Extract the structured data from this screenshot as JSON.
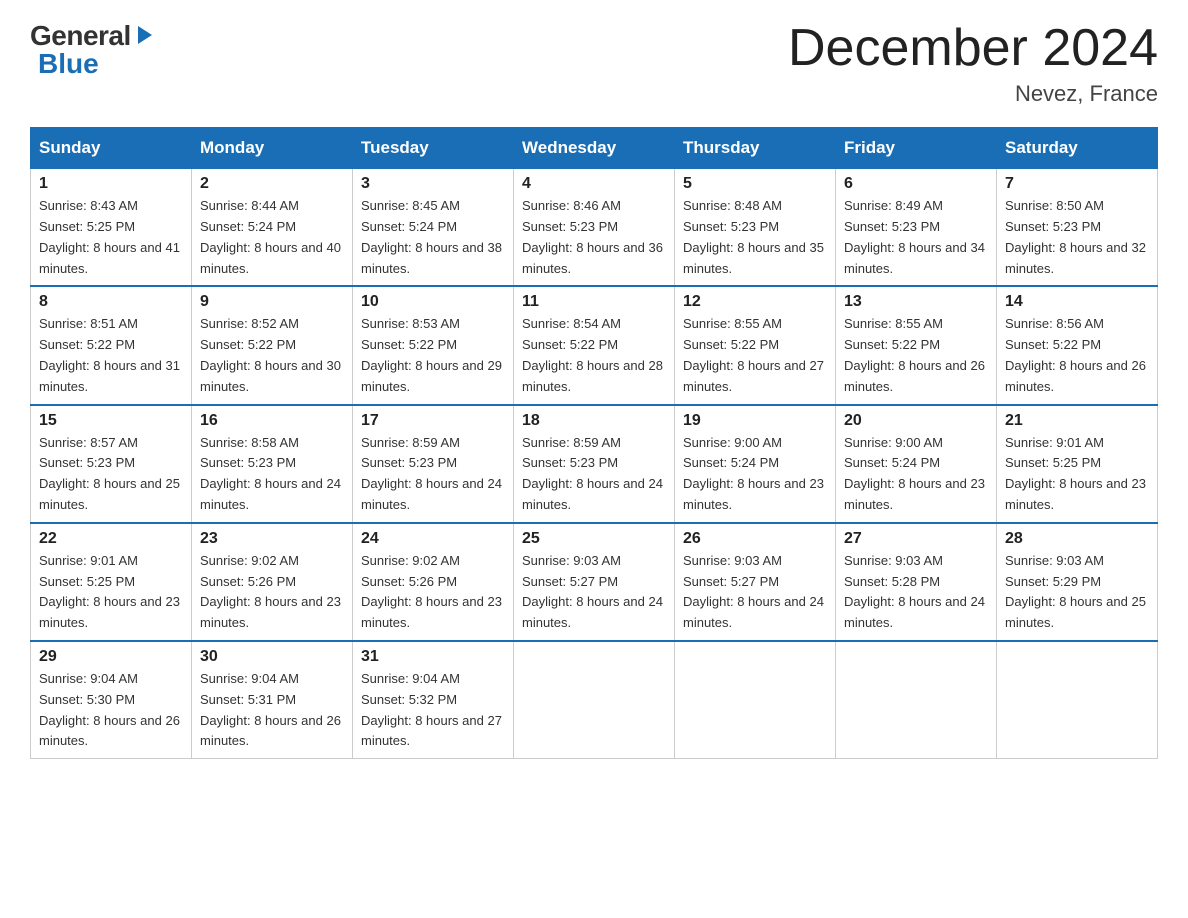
{
  "header": {
    "logo_general": "General",
    "logo_blue": "Blue",
    "title": "December 2024",
    "subtitle": "Nevez, France"
  },
  "calendar": {
    "weekdays": [
      "Sunday",
      "Monday",
      "Tuesday",
      "Wednesday",
      "Thursday",
      "Friday",
      "Saturday"
    ],
    "weeks": [
      [
        {
          "day": "1",
          "sunrise": "8:43 AM",
          "sunset": "5:25 PM",
          "daylight": "8 hours and 41 minutes."
        },
        {
          "day": "2",
          "sunrise": "8:44 AM",
          "sunset": "5:24 PM",
          "daylight": "8 hours and 40 minutes."
        },
        {
          "day": "3",
          "sunrise": "8:45 AM",
          "sunset": "5:24 PM",
          "daylight": "8 hours and 38 minutes."
        },
        {
          "day": "4",
          "sunrise": "8:46 AM",
          "sunset": "5:23 PM",
          "daylight": "8 hours and 36 minutes."
        },
        {
          "day": "5",
          "sunrise": "8:48 AM",
          "sunset": "5:23 PM",
          "daylight": "8 hours and 35 minutes."
        },
        {
          "day": "6",
          "sunrise": "8:49 AM",
          "sunset": "5:23 PM",
          "daylight": "8 hours and 34 minutes."
        },
        {
          "day": "7",
          "sunrise": "8:50 AM",
          "sunset": "5:23 PM",
          "daylight": "8 hours and 32 minutes."
        }
      ],
      [
        {
          "day": "8",
          "sunrise": "8:51 AM",
          "sunset": "5:22 PM",
          "daylight": "8 hours and 31 minutes."
        },
        {
          "day": "9",
          "sunrise": "8:52 AM",
          "sunset": "5:22 PM",
          "daylight": "8 hours and 30 minutes."
        },
        {
          "day": "10",
          "sunrise": "8:53 AM",
          "sunset": "5:22 PM",
          "daylight": "8 hours and 29 minutes."
        },
        {
          "day": "11",
          "sunrise": "8:54 AM",
          "sunset": "5:22 PM",
          "daylight": "8 hours and 28 minutes."
        },
        {
          "day": "12",
          "sunrise": "8:55 AM",
          "sunset": "5:22 PM",
          "daylight": "8 hours and 27 minutes."
        },
        {
          "day": "13",
          "sunrise": "8:55 AM",
          "sunset": "5:22 PM",
          "daylight": "8 hours and 26 minutes."
        },
        {
          "day": "14",
          "sunrise": "8:56 AM",
          "sunset": "5:22 PM",
          "daylight": "8 hours and 26 minutes."
        }
      ],
      [
        {
          "day": "15",
          "sunrise": "8:57 AM",
          "sunset": "5:23 PM",
          "daylight": "8 hours and 25 minutes."
        },
        {
          "day": "16",
          "sunrise": "8:58 AM",
          "sunset": "5:23 PM",
          "daylight": "8 hours and 24 minutes."
        },
        {
          "day": "17",
          "sunrise": "8:59 AM",
          "sunset": "5:23 PM",
          "daylight": "8 hours and 24 minutes."
        },
        {
          "day": "18",
          "sunrise": "8:59 AM",
          "sunset": "5:23 PM",
          "daylight": "8 hours and 24 minutes."
        },
        {
          "day": "19",
          "sunrise": "9:00 AM",
          "sunset": "5:24 PM",
          "daylight": "8 hours and 23 minutes."
        },
        {
          "day": "20",
          "sunrise": "9:00 AM",
          "sunset": "5:24 PM",
          "daylight": "8 hours and 23 minutes."
        },
        {
          "day": "21",
          "sunrise": "9:01 AM",
          "sunset": "5:25 PM",
          "daylight": "8 hours and 23 minutes."
        }
      ],
      [
        {
          "day": "22",
          "sunrise": "9:01 AM",
          "sunset": "5:25 PM",
          "daylight": "8 hours and 23 minutes."
        },
        {
          "day": "23",
          "sunrise": "9:02 AM",
          "sunset": "5:26 PM",
          "daylight": "8 hours and 23 minutes."
        },
        {
          "day": "24",
          "sunrise": "9:02 AM",
          "sunset": "5:26 PM",
          "daylight": "8 hours and 23 minutes."
        },
        {
          "day": "25",
          "sunrise": "9:03 AM",
          "sunset": "5:27 PM",
          "daylight": "8 hours and 24 minutes."
        },
        {
          "day": "26",
          "sunrise": "9:03 AM",
          "sunset": "5:27 PM",
          "daylight": "8 hours and 24 minutes."
        },
        {
          "day": "27",
          "sunrise": "9:03 AM",
          "sunset": "5:28 PM",
          "daylight": "8 hours and 24 minutes."
        },
        {
          "day": "28",
          "sunrise": "9:03 AM",
          "sunset": "5:29 PM",
          "daylight": "8 hours and 25 minutes."
        }
      ],
      [
        {
          "day": "29",
          "sunrise": "9:04 AM",
          "sunset": "5:30 PM",
          "daylight": "8 hours and 26 minutes."
        },
        {
          "day": "30",
          "sunrise": "9:04 AM",
          "sunset": "5:31 PM",
          "daylight": "8 hours and 26 minutes."
        },
        {
          "day": "31",
          "sunrise": "9:04 AM",
          "sunset": "5:32 PM",
          "daylight": "8 hours and 27 minutes."
        },
        null,
        null,
        null,
        null
      ]
    ]
  },
  "labels": {
    "sunrise_prefix": "Sunrise: ",
    "sunset_prefix": "Sunset: ",
    "daylight_prefix": "Daylight: "
  }
}
